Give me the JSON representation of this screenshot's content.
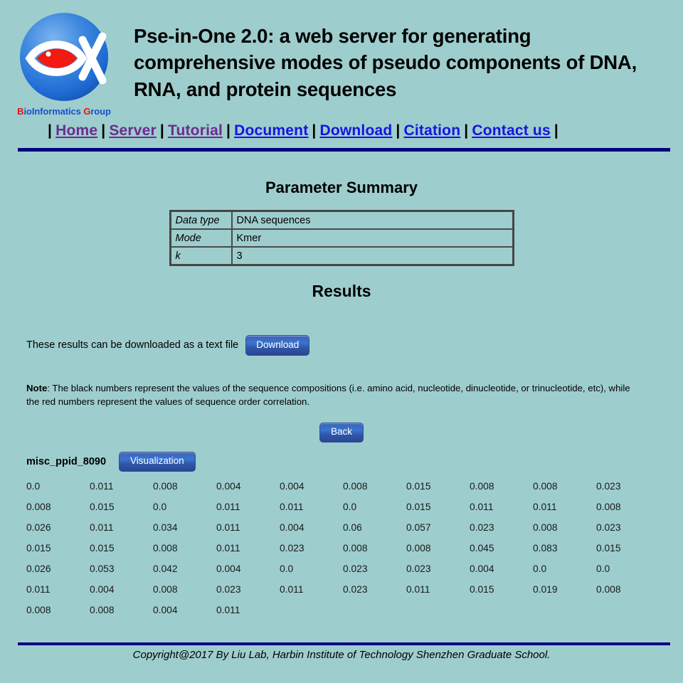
{
  "site": {
    "title": "Pse-in-One 2.0: a web server for generating comprehensive modes of pseudo components of DNA, RNA, and protein sequences",
    "logo_caption_b": "B",
    "logo_caption_io": "io",
    "logo_caption_informatics": "Informatics ",
    "logo_caption_g": "G",
    "logo_caption_roup": "roup",
    "logo_alt": "bioinformatics-fish-logo"
  },
  "nav": {
    "separator": "|",
    "items": [
      {
        "label": "Home",
        "state": "visited"
      },
      {
        "label": "Server",
        "state": "visited"
      },
      {
        "label": "Tutorial",
        "state": "visited"
      },
      {
        "label": "Document",
        "state": "unvisited"
      },
      {
        "label": "Download",
        "state": "unvisited"
      },
      {
        "label": "Citation",
        "state": "unvisited"
      },
      {
        "label": "Contact us",
        "state": "unvisited"
      }
    ]
  },
  "parameter_summary": {
    "heading": "Parameter Summary",
    "rows": [
      {
        "key": "Data type",
        "value": "DNA sequences"
      },
      {
        "key": "Mode",
        "value": "Kmer"
      },
      {
        "key": "k",
        "value": "3"
      }
    ]
  },
  "results": {
    "heading": "Results",
    "download_text": "These results can be downloaded as a text file",
    "download_label": "Download",
    "note_prefix": "Note",
    "note_body": ": The black numbers represent the values of the sequence compositions (i.e. amino acid, nucleotide, dinucleotide, or trinucleotide, etc), while the red numbers represent the values of sequence order correlation.",
    "back_label": "Back",
    "sequence_id": "misc_ppid_8090",
    "visualization_label": "Visualization",
    "columns": 10,
    "values": [
      [
        "0.0",
        "0.011",
        "0.008",
        "0.004",
        "0.004",
        "0.008",
        "0.015",
        "0.008",
        "0.008",
        "0.023"
      ],
      [
        "0.008",
        "0.015",
        "0.0",
        "0.011",
        "0.011",
        "0.0",
        "0.015",
        "0.011",
        "0.011",
        "0.008"
      ],
      [
        "0.026",
        "0.011",
        "0.034",
        "0.011",
        "0.004",
        "0.06",
        "0.057",
        "0.023",
        "0.008",
        "0.023"
      ],
      [
        "0.015",
        "0.015",
        "0.008",
        "0.011",
        "0.023",
        "0.008",
        "0.008",
        "0.045",
        "0.083",
        "0.015"
      ],
      [
        "0.026",
        "0.053",
        "0.042",
        "0.004",
        "0.0",
        "0.023",
        "0.023",
        "0.004",
        "0.0",
        "0.0"
      ],
      [
        "0.011",
        "0.004",
        "0.008",
        "0.023",
        "0.011",
        "0.023",
        "0.011",
        "0.015",
        "0.019",
        "0.008"
      ],
      [
        "0.008",
        "0.008",
        "0.004",
        "0.011"
      ]
    ]
  },
  "footer": {
    "text": "Copyright@2017 By Liu Lab, Harbin Institute of Technology Shenzhen Graduate School."
  },
  "colors": {
    "background": "#9ecdcd",
    "rule": "#000080",
    "link_visited": "#6b2d8f",
    "link_unvisited": "#1414e0",
    "button_blue": "#3a74cf",
    "logo_red": "#e81010",
    "logo_blue": "#1a4fd0"
  }
}
